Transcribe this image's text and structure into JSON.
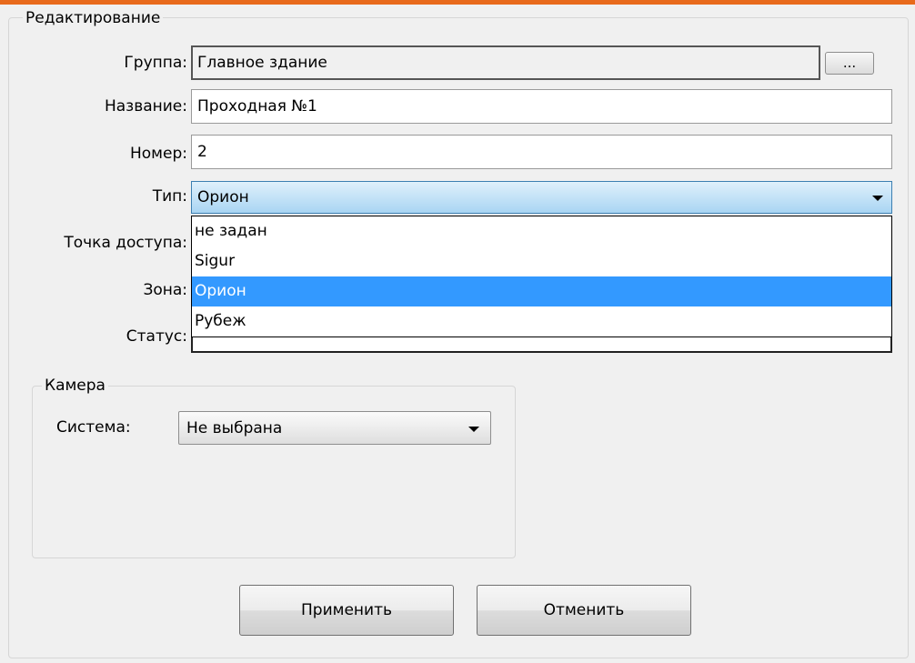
{
  "editing": {
    "title": "Редактирование",
    "fields": {
      "group": {
        "label": "Группа:",
        "value": "Главное здание",
        "browse_label": "..."
      },
      "name": {
        "label": "Название:",
        "value": "Проходная №1"
      },
      "number": {
        "label": "Номер:",
        "value": "2"
      },
      "type": {
        "label": "Тип:",
        "value": "Орион",
        "options": [
          "не задан",
          "Sigur",
          "Орион",
          "Рубеж"
        ],
        "selected": "Орион"
      },
      "access_point": {
        "label": "Точка доступа:"
      },
      "zone": {
        "label": "Зона:"
      },
      "status": {
        "label": "Статус:"
      }
    }
  },
  "camera": {
    "title": "Камера",
    "system_label": "Система:",
    "system_value": "Не выбрана"
  },
  "buttons": {
    "apply": "Применить",
    "cancel": "Отменить"
  },
  "colors": {
    "accent": "#e86a1c",
    "selection": "#3399ff",
    "background": "#f0f0f0"
  },
  "icons": {
    "combo_arrow": "chevron-down-icon"
  }
}
